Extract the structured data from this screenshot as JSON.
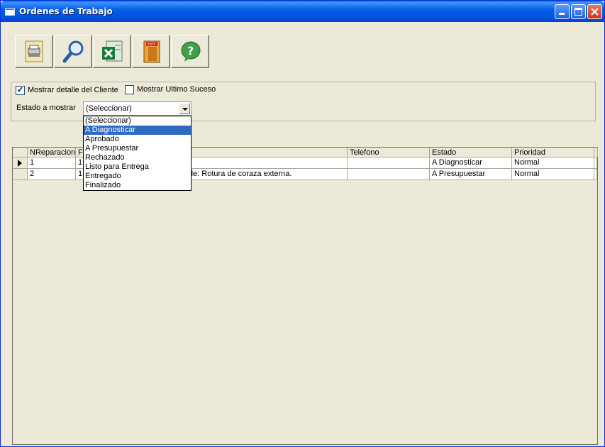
{
  "window": {
    "title": "Ordenes de Trabajo",
    "controls": {
      "minimize": "minimize-icon",
      "maximize": "maximize-icon",
      "close": "close-icon"
    }
  },
  "toolbar": [
    {
      "name": "print-report-button",
      "icon": "report-icon"
    },
    {
      "name": "search-button",
      "icon": "magnifier-icon"
    },
    {
      "name": "export-excel-button",
      "icon": "excel-icon"
    },
    {
      "name": "exit-button",
      "icon": "exit-door-icon"
    },
    {
      "name": "help-button",
      "icon": "help-question-icon"
    }
  ],
  "filters": {
    "show_client_detail": {
      "label": "Mostrar detalle del Cliente",
      "checked": true
    },
    "show_last_event": {
      "label": "Mostrar Ultimo Suceso",
      "checked": false
    },
    "state_label": "Estado a mostrar",
    "state_value": "(Seleccionar)",
    "state_options": [
      "(Seleccionar)",
      "A Diagnosticar",
      "Aprobado",
      "A Presupuestar",
      "Rechazado",
      "Listo para Entrega",
      "Entregado",
      "Finalizado"
    ],
    "highlighted_option": "A Diagnosticar"
  },
  "grid": {
    "columns": [
      "NReparacion",
      "F",
      "",
      "Telefono",
      "Estado",
      "Prioridad"
    ],
    "rows": [
      {
        "nreparacion": "1",
        "f": "1:",
        "detalle": "",
        "telefono": "",
        "estado": "A Diagnosticar",
        "prioridad": "Normal"
      },
      {
        "nreparacion": "2",
        "f": "1:",
        "detalle": "talle: Rotura de coraza externa.",
        "telefono": "",
        "estado": "A Presupuestar",
        "prioridad": "Normal"
      }
    ]
  },
  "colors": {
    "titlebar": "#0054e3",
    "selection": "#316ac5",
    "face": "#ece9d8"
  }
}
